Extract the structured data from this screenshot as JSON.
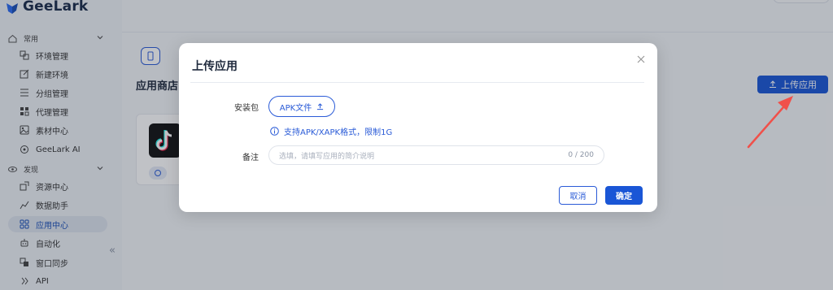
{
  "brand": {
    "name": "GeeLark"
  },
  "sidebar": {
    "groups": [
      {
        "label": "常用",
        "icon": "home-icon"
      },
      {
        "label": "发现",
        "icon": "eye-icon"
      }
    ],
    "items": [
      {
        "label": "环境管理",
        "icon": "environment-icon"
      },
      {
        "label": "新建环境",
        "icon": "edit-icon"
      },
      {
        "label": "分组管理",
        "icon": "list-icon"
      },
      {
        "label": "代理管理",
        "icon": "proxy-icon"
      },
      {
        "label": "素材中心",
        "icon": "image-icon"
      },
      {
        "label": "GeeLark AI",
        "icon": "ai-icon"
      },
      {
        "label": "资源中心",
        "icon": "resource-icon"
      },
      {
        "label": "数据助手",
        "icon": "chart-icon"
      },
      {
        "label": "应用中心",
        "icon": "apps-icon",
        "active": true
      },
      {
        "label": "自动化",
        "icon": "robot-icon"
      },
      {
        "label": "窗口同步",
        "icon": "sync-icon"
      },
      {
        "label": "API",
        "icon": "api-icon"
      }
    ],
    "collapse_glyph": "«"
  },
  "page": {
    "title": "应用商店",
    "upload_button": "上传应用"
  },
  "modal": {
    "title": "上传应用",
    "package_label": "安装包",
    "apk_button": "APK文件",
    "hint": "支持APK/XAPK格式，限制1G",
    "note_label": "备注",
    "note_placeholder": "选填，请填写应用的简介说明",
    "note_count": "0 / 200",
    "cancel": "取消",
    "confirm": "确定"
  },
  "colors": {
    "primary": "#1a56d6",
    "arrow": "#f0504a",
    "active_bg": "#dde3ee"
  }
}
